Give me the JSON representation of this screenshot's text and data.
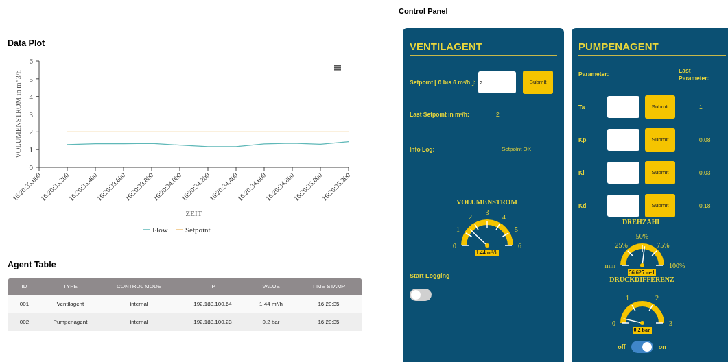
{
  "data_plot": {
    "title": "Data Plot",
    "chart_data": {
      "type": "line",
      "xlabel": "ZEIT",
      "ylabel": "VOLUMENSTROM in m^3/h",
      "categories": [
        "16:20:33.000",
        "16:20:33.200",
        "16:20:33.400",
        "16:20:33.600",
        "16:20:33.800",
        "16:20:34.000",
        "16:20:34.200",
        "16:20:34.400",
        "16:20:34.600",
        "16:20:34.800",
        "16:20:35.000",
        "16:20:35.200"
      ],
      "series": [
        {
          "name": "Flow",
          "color": "#5fb8b8",
          "values": [
            null,
            1.28,
            1.33,
            1.33,
            1.35,
            1.25,
            1.17,
            1.17,
            1.32,
            1.36,
            1.3,
            1.45
          ]
        },
        {
          "name": "Setpoint",
          "color": "#f0c27a",
          "values": [
            null,
            2,
            2,
            2,
            2,
            2,
            2,
            2,
            2,
            2,
            2,
            2
          ]
        }
      ],
      "ylim": [
        0,
        6
      ],
      "yticks": [
        0,
        1,
        2,
        3,
        4,
        5,
        6
      ],
      "legend": "bottom"
    }
  },
  "agent_table": {
    "title": "Agent Table",
    "columns": [
      "ID",
      "TYPE",
      "CONTROL MODE",
      "IP",
      "VALUE",
      "TIME STAMP"
    ],
    "rows": [
      [
        "001",
        "Ventilagent",
        "internal",
        "192.188.100.64",
        "1.44 m³/h",
        "16:20:35"
      ],
      [
        "002",
        "Pumpenagent",
        "internal",
        "192.188.100.23",
        "0.2 bar",
        "16:20:35"
      ]
    ]
  },
  "control_panel": {
    "title": "Control Panel",
    "ventilagent": {
      "title": "VENTILAGENT",
      "setpoint_label": "Setpoint [ 0 bis 6 m³/h ]:",
      "setpoint_value": "2",
      "submit": "Submit",
      "last_setpoint_label": "Last Setpoint in m³/h:",
      "last_setpoint": "2",
      "info_log_label": "Info Log:",
      "info_log": "Setpoint OK",
      "gauge": {
        "title": "VOLUMENSTROM",
        "labels": [
          "0",
          "1",
          "2",
          "3",
          "4",
          "5",
          "6"
        ],
        "reading": "1.44 m³/h"
      },
      "logging_label": "Start Logging",
      "logging": {
        "checked": false
      }
    },
    "pumpenagent": {
      "title": "PUMPENAGENT",
      "parameter_label": "Parameter:",
      "last_parameter_label": "Last Parameter:",
      "parameters": [
        {
          "name": "Ta",
          "submit": "Submit",
          "last": "1"
        },
        {
          "name": "Kp",
          "submit": "Submit",
          "last": "0.08"
        },
        {
          "name": "Ki",
          "submit": "Submit",
          "last": "0.03"
        },
        {
          "name": "Kd",
          "submit": "Submit",
          "last": "0.18"
        }
      ],
      "gauges": [
        {
          "title": "DREHZAHL",
          "labels": [
            "min",
            "25%",
            "50%",
            "75%",
            "100%"
          ],
          "reading": "56.625 m-1"
        },
        {
          "title": "DRUCKDIFFERENZ",
          "labels": [
            "0",
            "1",
            "2",
            "3"
          ],
          "reading": "0.2 bar"
        }
      ],
      "switch": {
        "off_label": "off",
        "on_label": "on",
        "on": true
      }
    }
  }
}
